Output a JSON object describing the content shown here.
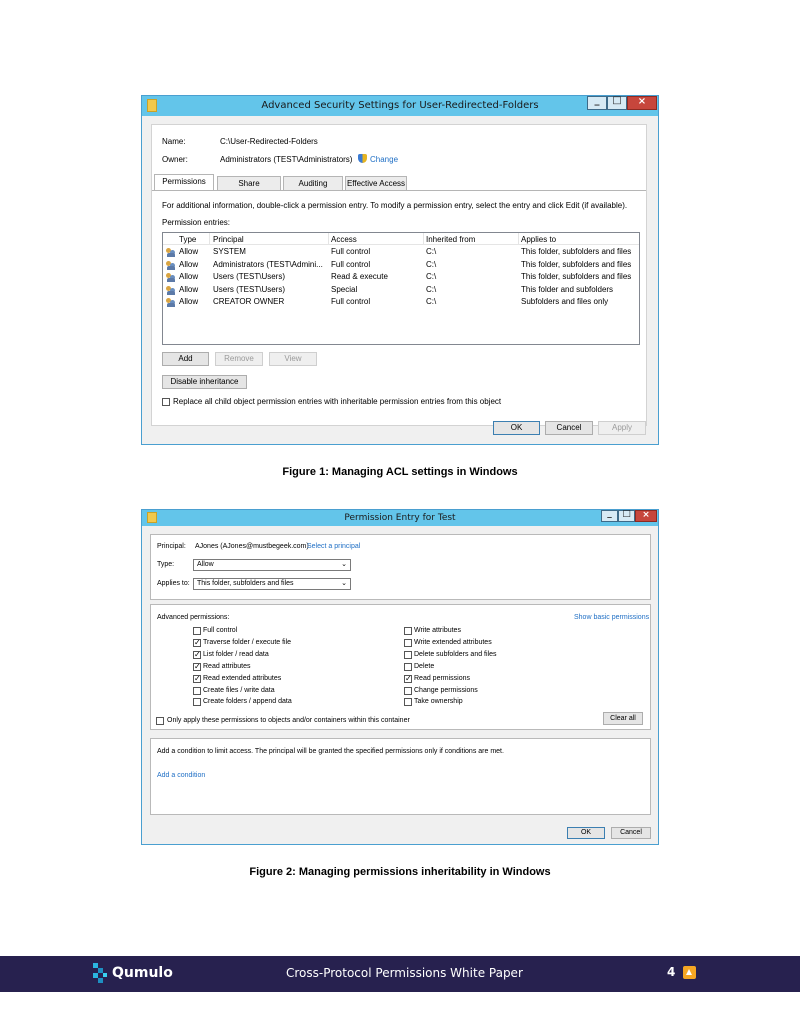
{
  "fig1": {
    "window_title": "Advanced Security Settings for User-Redirected-Folders",
    "name_label": "Name:",
    "name_value": "C:\\User-Redirected-Folders",
    "owner_label": "Owner:",
    "owner_value": "Administrators (TEST\\Administrators)",
    "change_link": "Change",
    "tabs": [
      "Permissions",
      "Share",
      "Auditing",
      "Effective Access"
    ],
    "info_text": "For additional information, double-click a permission entry. To modify a permission entry, select the entry and click Edit (if available).",
    "entries_label": "Permission entries:",
    "columns": [
      "Type",
      "Principal",
      "Access",
      "Inherited from",
      "Applies to"
    ],
    "rows": [
      [
        "Allow",
        "SYSTEM",
        "Full control",
        "C:\\",
        "This folder, subfolders and files"
      ],
      [
        "Allow",
        "Administrators (TEST\\Admini...",
        "Full control",
        "C:\\",
        "This folder, subfolders and files"
      ],
      [
        "Allow",
        "Users (TEST\\Users)",
        "Read & execute",
        "C:\\",
        "This folder, subfolders and files"
      ],
      [
        "Allow",
        "Users (TEST\\Users)",
        "Special",
        "C:\\",
        "This folder and subfolders"
      ],
      [
        "Allow",
        "CREATOR OWNER",
        "Full control",
        "C:\\",
        "Subfolders and files only"
      ]
    ],
    "add_button": "Add",
    "remove_button": "Remove",
    "view_button": "View",
    "disable_inheritance_button": "Disable inheritance",
    "replace_checkbox_label": "Replace all child object permission entries with inheritable permission entries from this object",
    "ok_button": "OK",
    "cancel_button": "Cancel",
    "apply_button": "Apply"
  },
  "caption1": "Figure 1: Managing ACL settings in Windows",
  "fig2": {
    "window_title": "Permission Entry for Test",
    "principal_label": "Principal:",
    "principal_value": "AJones (AJones@mustbegeek.com)",
    "select_principal_link": "Select a principal",
    "type_label": "Type:",
    "type_value": "Allow",
    "applies_label": "Applies to:",
    "applies_value": "This folder, subfolders and files",
    "adv_label": "Advanced permissions:",
    "show_basic_link": "Show basic permissions",
    "left_perms": [
      {
        "label": "Full control",
        "checked": false
      },
      {
        "label": "Traverse folder / execute file",
        "checked": true
      },
      {
        "label": "List folder / read data",
        "checked": true
      },
      {
        "label": "Read attributes",
        "checked": true
      },
      {
        "label": "Read extended attributes",
        "checked": true
      },
      {
        "label": "Create files / write data",
        "checked": false
      },
      {
        "label": "Create folders / append data",
        "checked": false
      }
    ],
    "right_perms": [
      {
        "label": "Write attributes",
        "checked": false
      },
      {
        "label": "Write extended attributes",
        "checked": false
      },
      {
        "label": "Delete subfolders and files",
        "checked": false
      },
      {
        "label": "Delete",
        "checked": false
      },
      {
        "label": "Read permissions",
        "checked": true
      },
      {
        "label": "Change permissions",
        "checked": false
      },
      {
        "label": "Take ownership",
        "checked": false
      }
    ],
    "only_apply_label": "Only apply these permissions to objects and/or containers within this container",
    "clear_all_button": "Clear all",
    "condition_text": "Add a condition to limit access. The principal will be granted the specified permissions only if conditions are met.",
    "add_condition_link": "Add a condition",
    "ok_button": "OK",
    "cancel_button": "Cancel"
  },
  "caption2": "Figure 2: Managing permissions inheritability in Windows",
  "footer": {
    "brand": "Qumulo",
    "title": "Cross-Protocol Permissions White Paper",
    "page_number": "4"
  },
  "colors": {
    "titlebar": "#63c5ea",
    "footer_bg": "#27214f",
    "link": "#1f6fc5",
    "accent_orange": "#f5a623"
  }
}
